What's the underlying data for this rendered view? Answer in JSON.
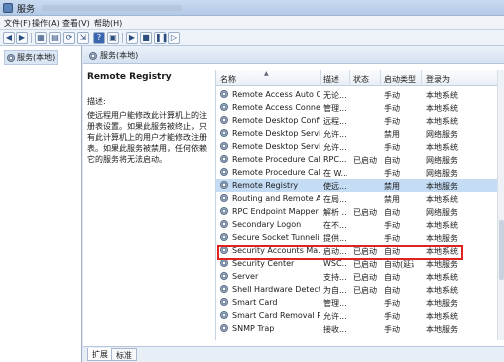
{
  "window": {
    "title": "服务"
  },
  "menu": [
    "文件(F)",
    "操作(A)",
    "查看(V)",
    "帮助(H)"
  ],
  "toolbar_icons": [
    "back-arrow-icon",
    "forward-arrow-icon",
    "console-tree-icon",
    "properties-icon",
    "refresh-icon",
    "export-icon",
    "help-icon",
    "view-icon",
    "play-icon",
    "stop-icon",
    "pause-icon",
    "restart-icon"
  ],
  "tree": {
    "root_label": "服务(本地)"
  },
  "pane": {
    "header_label": "服务(本地)"
  },
  "details": {
    "service_name": "Remote Registry",
    "desc_label": "描述:",
    "desc_text": "使远程用户能修改此计算机上的注册表设置。如果此服务被终止，只有此计算机上的用户才能修改注册表。如果此服务被禁用，任何依赖它的服务将无法启动。"
  },
  "columns": {
    "name": "名称",
    "desc": "描述",
    "status": "状态",
    "startup": "启动类型",
    "logon": "登录为"
  },
  "services": [
    {
      "name": "Remote Access Auto C...",
      "desc": "无论...",
      "status": "",
      "startup": "手动",
      "logon": "本地系统"
    },
    {
      "name": "Remote Access Conne...",
      "desc": "管理...",
      "status": "",
      "startup": "手动",
      "logon": "本地系统"
    },
    {
      "name": "Remote Desktop Confi...",
      "desc": "远程...",
      "status": "",
      "startup": "手动",
      "logon": "本地系统"
    },
    {
      "name": "Remote Desktop Servi...",
      "desc": "允许...",
      "status": "",
      "startup": "禁用",
      "logon": "网络服务"
    },
    {
      "name": "Remote Desktop Servi...",
      "desc": "允许...",
      "status": "",
      "startup": "手动",
      "logon": "本地系统"
    },
    {
      "name": "Remote Procedure Cal...",
      "desc": "RPC...",
      "status": "已启动",
      "startup": "自动",
      "logon": "网络服务"
    },
    {
      "name": "Remote Procedure Cal...",
      "desc": "在 W...",
      "status": "",
      "startup": "手动",
      "logon": "网络服务"
    },
    {
      "name": "Remote Registry",
      "desc": "使远...",
      "status": "",
      "startup": "禁用",
      "logon": "本地服务",
      "selected": true
    },
    {
      "name": "Routing and Remote A...",
      "desc": "在局...",
      "status": "",
      "startup": "禁用",
      "logon": "本地系统"
    },
    {
      "name": "RPC Endpoint Mapper",
      "desc": "解析 ...",
      "status": "已启动",
      "startup": "自动",
      "logon": "网络服务"
    },
    {
      "name": "Secondary Logon",
      "desc": "在不...",
      "status": "",
      "startup": "手动",
      "logon": "本地系统"
    },
    {
      "name": "Secure Socket Tunneli...",
      "desc": "提供...",
      "status": "",
      "startup": "手动",
      "logon": "本地服务"
    },
    {
      "name": "Security Accounts Ma...",
      "desc": "启动...",
      "status": "已启动",
      "startup": "自动",
      "logon": "本地系统"
    },
    {
      "name": "Security Center",
      "desc": "WSC...",
      "status": "已启动",
      "startup": "自动(延迟...",
      "logon": "本地服务"
    },
    {
      "name": "Server",
      "desc": "支持...",
      "status": "已启动",
      "startup": "自动",
      "logon": "本地系统"
    },
    {
      "name": "Shell Hardware Detecti...",
      "desc": "为自...",
      "status": "已启动",
      "startup": "自动",
      "logon": "本地系统"
    },
    {
      "name": "Smart Card",
      "desc": "管理...",
      "status": "",
      "startup": "手动",
      "logon": "本地服务"
    },
    {
      "name": "Smart Card Removal P...",
      "desc": "允许...",
      "status": "",
      "startup": "手动",
      "logon": "本地系统"
    },
    {
      "name": "SNMP Trap",
      "desc": "接收...",
      "status": "",
      "startup": "手动",
      "logon": "本地服务"
    }
  ],
  "tabs": [
    "扩展",
    "标准"
  ]
}
